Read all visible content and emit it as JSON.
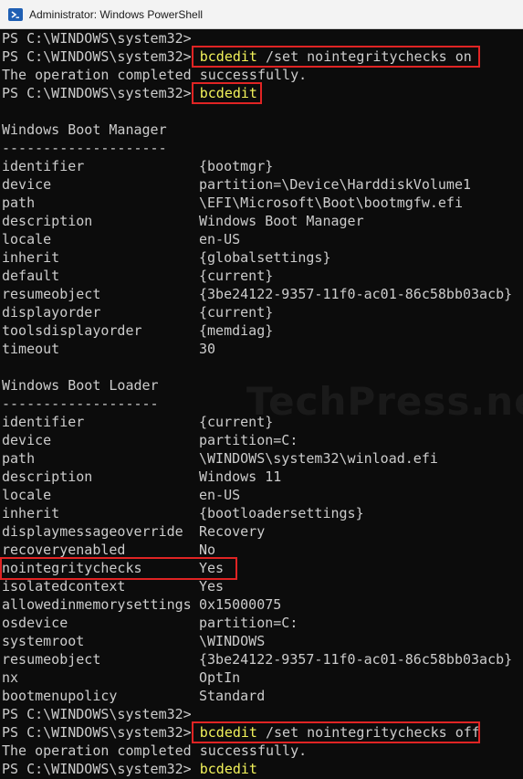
{
  "window": {
    "title": "Administrator: Windows PowerShell",
    "icon": "powershell-icon"
  },
  "prompt": "PS C:\\WINDOWS\\system32>",
  "commands": {
    "set_on": {
      "cmd": "bcdedit",
      "args": " /set nointegritychecks on"
    },
    "view": {
      "cmd": "bcdedit",
      "args": ""
    },
    "set_off": {
      "cmd": "bcdedit",
      "args": " /set nointegritychecks off"
    },
    "last": {
      "cmd": "bcdedit",
      "args": ""
    }
  },
  "success_message": "The operation completed successfully.",
  "boot_manager": {
    "header": "Windows Boot Manager",
    "separator": "--------------------",
    "entries": [
      {
        "key": "identifier",
        "value": "{bootmgr}"
      },
      {
        "key": "device",
        "value": "partition=\\Device\\HarddiskVolume1"
      },
      {
        "key": "path",
        "value": "\\EFI\\Microsoft\\Boot\\bootmgfw.efi"
      },
      {
        "key": "description",
        "value": "Windows Boot Manager"
      },
      {
        "key": "locale",
        "value": "en-US"
      },
      {
        "key": "inherit",
        "value": "{globalsettings}"
      },
      {
        "key": "default",
        "value": "{current}"
      },
      {
        "key": "resumeobject",
        "value": "{3be24122-9357-11f0-ac01-86c58bb03acb}"
      },
      {
        "key": "displayorder",
        "value": "{current}"
      },
      {
        "key": "toolsdisplayorder",
        "value": "{memdiag}"
      },
      {
        "key": "timeout",
        "value": "30"
      }
    ]
  },
  "boot_loader": {
    "header": "Windows Boot Loader",
    "separator": "-------------------",
    "entries": [
      {
        "key": "identifier",
        "value": "{current}"
      },
      {
        "key": "device",
        "value": "partition=C:"
      },
      {
        "key": "path",
        "value": "\\WINDOWS\\system32\\winload.efi"
      },
      {
        "key": "description",
        "value": "Windows 11"
      },
      {
        "key": "locale",
        "value": "en-US"
      },
      {
        "key": "inherit",
        "value": "{bootloadersettings}"
      },
      {
        "key": "displaymessageoverride",
        "value": "Recovery"
      },
      {
        "key": "recoveryenabled",
        "value": "No"
      },
      {
        "key": "nointegritychecks",
        "value": "Yes"
      },
      {
        "key": "isolatedcontext",
        "value": "Yes"
      },
      {
        "key": "allowedinmemorysettings",
        "value": "0x15000075"
      },
      {
        "key": "osdevice",
        "value": "partition=C:"
      },
      {
        "key": "systemroot",
        "value": "\\WINDOWS"
      },
      {
        "key": "resumeobject",
        "value": "{3be24122-9357-11f0-ac01-86c58bb03acb}"
      },
      {
        "key": "nx",
        "value": "OptIn"
      },
      {
        "key": "bootmenupolicy",
        "value": "Standard"
      }
    ]
  },
  "watermark": "TechPress.net",
  "colors": {
    "background": "#0c0c0c",
    "text": "#cccccc",
    "command": "#f2f25a",
    "highlight": "#e02424"
  }
}
